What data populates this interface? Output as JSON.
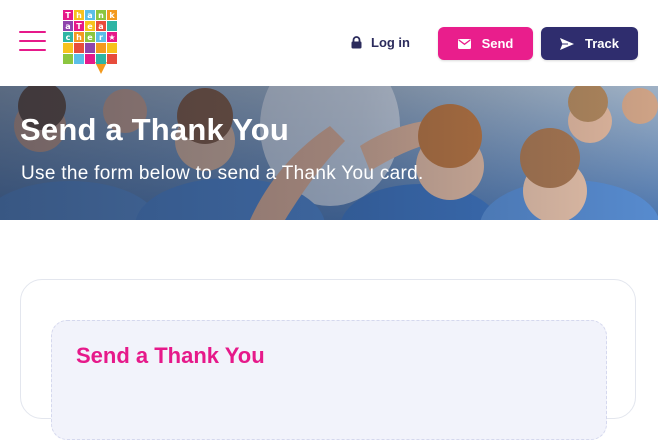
{
  "header": {
    "logo_text": "Thank a Teacher",
    "login_label": "Log in",
    "send_label": "Send",
    "track_label": "Track"
  },
  "hero": {
    "title": "Send a Thank You",
    "subtitle": "Use the form below to send a Thank You card."
  },
  "form": {
    "title": "Send a Thank You"
  },
  "colors": {
    "brand_pink": "#e91e8c",
    "brand_navy": "#2f2d6e",
    "text_dark": "#2b2b5c"
  },
  "icons": {
    "menu": "hamburger-menu-icon",
    "login": "lock-icon",
    "send": "envelope-icon",
    "track": "paper-plane-icon"
  }
}
